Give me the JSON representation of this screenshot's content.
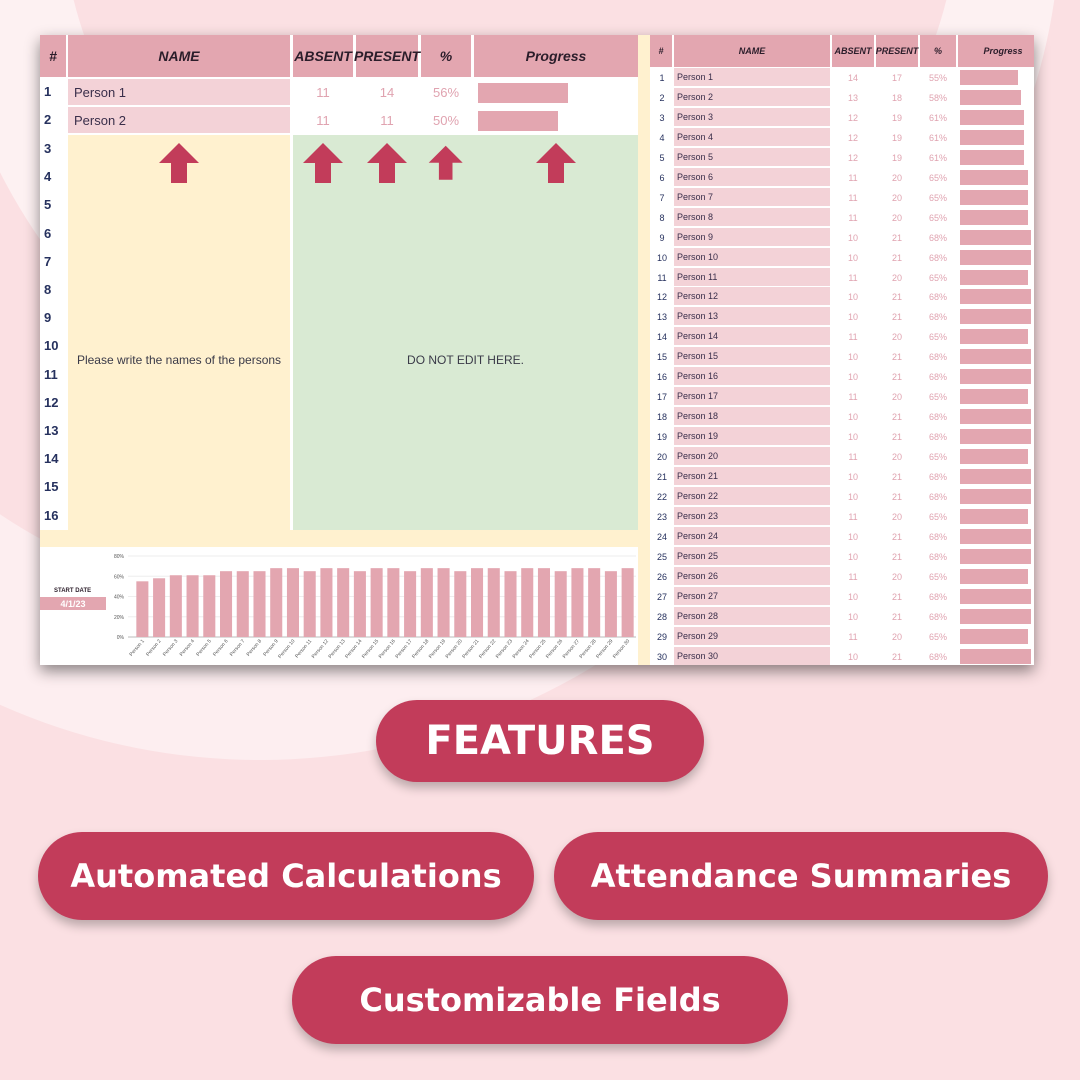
{
  "colors": {
    "accent": "#c23c5a",
    "header_pink": "#e3a6b0",
    "name_cell_pink": "#f3d2d7",
    "input_zone_yellow": "#fff1cf",
    "locked_zone_green": "#d9ead3",
    "background": "#fbe0e3"
  },
  "left_table": {
    "headers": [
      "#",
      "NAME",
      "ABSENT",
      "PRESENT",
      "%",
      "Progress"
    ],
    "rows": [
      {
        "num": "1",
        "name": "Person 1",
        "absent": "11",
        "present": "14",
        "pct": "56%",
        "progress": 0.56
      },
      {
        "num": "2",
        "name": "Person 2",
        "absent": "11",
        "present": "11",
        "pct": "50%",
        "progress": 0.5
      }
    ],
    "row_numbers": [
      "3",
      "4",
      "5",
      "6",
      "7",
      "8",
      "9",
      "10",
      "11",
      "12",
      "13",
      "14",
      "15",
      "16"
    ],
    "input_note": "Please write the names of the persons",
    "locked_note": "DO NOT EDIT HERE.",
    "arrow_icon": "up-arrow-icon"
  },
  "start_date": {
    "label": "START DATE",
    "value": "4/1/23"
  },
  "right_table": {
    "headers": [
      "#",
      "NAME",
      "ABSENT",
      "PRESENT",
      "%",
      "Progress"
    ],
    "rows": [
      {
        "num": "1",
        "name": "Person 1",
        "absent": "14",
        "present": "17",
        "pct": "55%",
        "progress": 0.55
      },
      {
        "num": "2",
        "name": "Person 2",
        "absent": "13",
        "present": "18",
        "pct": "58%",
        "progress": 0.58
      },
      {
        "num": "3",
        "name": "Person 3",
        "absent": "12",
        "present": "19",
        "pct": "61%",
        "progress": 0.61
      },
      {
        "num": "4",
        "name": "Person 4",
        "absent": "12",
        "present": "19",
        "pct": "61%",
        "progress": 0.61
      },
      {
        "num": "5",
        "name": "Person 5",
        "absent": "12",
        "present": "19",
        "pct": "61%",
        "progress": 0.61
      },
      {
        "num": "6",
        "name": "Person 6",
        "absent": "11",
        "present": "20",
        "pct": "65%",
        "progress": 0.65
      },
      {
        "num": "7",
        "name": "Person 7",
        "absent": "11",
        "present": "20",
        "pct": "65%",
        "progress": 0.65
      },
      {
        "num": "8",
        "name": "Person 8",
        "absent": "11",
        "present": "20",
        "pct": "65%",
        "progress": 0.65
      },
      {
        "num": "9",
        "name": "Person 9",
        "absent": "10",
        "present": "21",
        "pct": "68%",
        "progress": 0.68
      },
      {
        "num": "10",
        "name": "Person 10",
        "absent": "10",
        "present": "21",
        "pct": "68%",
        "progress": 0.68
      },
      {
        "num": "11",
        "name": "Person 11",
        "absent": "11",
        "present": "20",
        "pct": "65%",
        "progress": 0.65
      },
      {
        "num": "12",
        "name": "Person 12",
        "absent": "10",
        "present": "21",
        "pct": "68%",
        "progress": 0.68
      },
      {
        "num": "13",
        "name": "Person 13",
        "absent": "10",
        "present": "21",
        "pct": "68%",
        "progress": 0.68
      },
      {
        "num": "14",
        "name": "Person 14",
        "absent": "11",
        "present": "20",
        "pct": "65%",
        "progress": 0.65
      },
      {
        "num": "15",
        "name": "Person 15",
        "absent": "10",
        "present": "21",
        "pct": "68%",
        "progress": 0.68
      },
      {
        "num": "16",
        "name": "Person 16",
        "absent": "10",
        "present": "21",
        "pct": "68%",
        "progress": 0.68
      },
      {
        "num": "17",
        "name": "Person 17",
        "absent": "11",
        "present": "20",
        "pct": "65%",
        "progress": 0.65
      },
      {
        "num": "18",
        "name": "Person 18",
        "absent": "10",
        "present": "21",
        "pct": "68%",
        "progress": 0.68
      },
      {
        "num": "19",
        "name": "Person 19",
        "absent": "10",
        "present": "21",
        "pct": "68%",
        "progress": 0.68
      },
      {
        "num": "20",
        "name": "Person 20",
        "absent": "11",
        "present": "20",
        "pct": "65%",
        "progress": 0.65
      },
      {
        "num": "21",
        "name": "Person 21",
        "absent": "10",
        "present": "21",
        "pct": "68%",
        "progress": 0.68
      },
      {
        "num": "22",
        "name": "Person 22",
        "absent": "10",
        "present": "21",
        "pct": "68%",
        "progress": 0.68
      },
      {
        "num": "23",
        "name": "Person 23",
        "absent": "11",
        "present": "20",
        "pct": "65%",
        "progress": 0.65
      },
      {
        "num": "24",
        "name": "Person 24",
        "absent": "10",
        "present": "21",
        "pct": "68%",
        "progress": 0.68
      },
      {
        "num": "25",
        "name": "Person 25",
        "absent": "10",
        "present": "21",
        "pct": "68%",
        "progress": 0.68
      },
      {
        "num": "26",
        "name": "Person 26",
        "absent": "11",
        "present": "20",
        "pct": "65%",
        "progress": 0.65
      },
      {
        "num": "27",
        "name": "Person 27",
        "absent": "10",
        "present": "21",
        "pct": "68%",
        "progress": 0.68
      },
      {
        "num": "28",
        "name": "Person 28",
        "absent": "10",
        "present": "21",
        "pct": "68%",
        "progress": 0.68
      },
      {
        "num": "29",
        "name": "Person 29",
        "absent": "11",
        "present": "20",
        "pct": "65%",
        "progress": 0.65
      },
      {
        "num": "30",
        "name": "Person 30",
        "absent": "10",
        "present": "21",
        "pct": "68%",
        "progress": 0.68
      }
    ]
  },
  "chart_data": {
    "type": "bar",
    "title": "",
    "xlabel": "",
    "ylabel": "",
    "categories": [
      "Person 1",
      "Person 2",
      "Person 3",
      "Person 4",
      "Person 5",
      "Person 6",
      "Person 7",
      "Person 8",
      "Person 9",
      "Person 10",
      "Person 11",
      "Person 12",
      "Person 13",
      "Person 14",
      "Person 15",
      "Person 16",
      "Person 17",
      "Person 18",
      "Person 19",
      "Person 20",
      "Person 21",
      "Person 22",
      "Person 23",
      "Person 24",
      "Person 25",
      "Person 26",
      "Person 27",
      "Person 28",
      "Person 29",
      "Person 30"
    ],
    "values": [
      55,
      58,
      61,
      61,
      61,
      65,
      65,
      65,
      68,
      68,
      65,
      68,
      68,
      65,
      68,
      68,
      65,
      68,
      68,
      65,
      68,
      68,
      65,
      68,
      68,
      65,
      68,
      68,
      65,
      68
    ],
    "ylim": [
      0,
      80
    ],
    "yticks": [
      "0%",
      "20%",
      "40%",
      "60%",
      "80%"
    ],
    "grid": true,
    "legend": "none",
    "color": "#e3a6b0"
  },
  "features": {
    "title": "FEATURES",
    "items": [
      "Automated Calculations",
      "Attendance Summaries",
      "Customizable Fields"
    ]
  }
}
